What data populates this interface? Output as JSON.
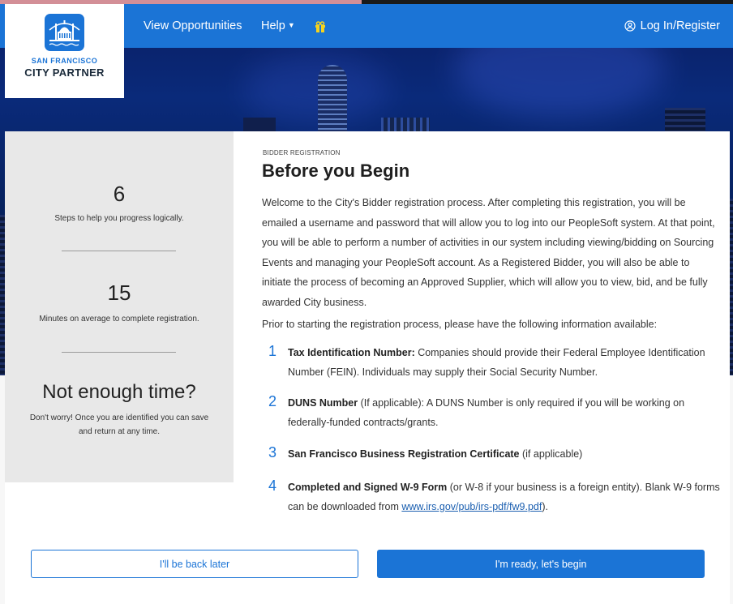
{
  "header": {
    "logo": {
      "line1": "SAN FRANCISCO",
      "line2": "CITY PARTNER"
    },
    "nav": {
      "view_opportunities": "View Opportunities",
      "help": "Help"
    },
    "login": "Log In/Register"
  },
  "stats": [
    {
      "number": "6",
      "caption": "Steps to help you progress logically."
    },
    {
      "number": "15",
      "caption": "Minutes on average to complete registration."
    }
  ],
  "not_enough_time": {
    "title": "Not enough time?",
    "text": "Don't worry! Once you are identified you can save and return at any time."
  },
  "main": {
    "eyebrow": "BIDDER REGISTRATION",
    "title": "Before you Begin",
    "intro": "Welcome to the City's Bidder registration process. After completing this registration, you will be emailed a username and password that will allow you to log into our PeopleSoft system. At that point, you will be able to perform a number of activities in our system including viewing/bidding on Sourcing Events and managing your PeopleSoft account. As a Registered Bidder, you will also be able to initiate the process of becoming an Approved Supplier, which will allow you to view, bid, and be fully awarded City business.",
    "prior": "Prior to starting the registration process, please have the following information available:",
    "requirements": [
      {
        "num": "1",
        "title": "Tax Identification Number:",
        "text": " Companies should provide their Federal Employee Identification Number (FEIN). Individuals may supply their Social Security Number."
      },
      {
        "num": "2",
        "title": "DUNS Number",
        "text": " (If applicable): A DUNS Number is only required if you will be working on federally-funded contracts/grants."
      },
      {
        "num": "3",
        "title": "San Francisco Business Registration Certificate",
        "text": " (if applicable)"
      },
      {
        "num": "4",
        "title": "Completed and Signed W-9 Form",
        "text": " (or W-8 if your business is a foreign entity). Blank W-9 forms can be downloaded from ",
        "link": "www.irs.gov/pub/irs-pdf/fw9.pdf",
        "tail": ")."
      }
    ]
  },
  "buttons": {
    "later": "I'll be back later",
    "ready": "I'm ready, let's begin"
  },
  "colors": {
    "brand_blue": "#1b74d6",
    "panel_gray": "#e8e8e8"
  }
}
